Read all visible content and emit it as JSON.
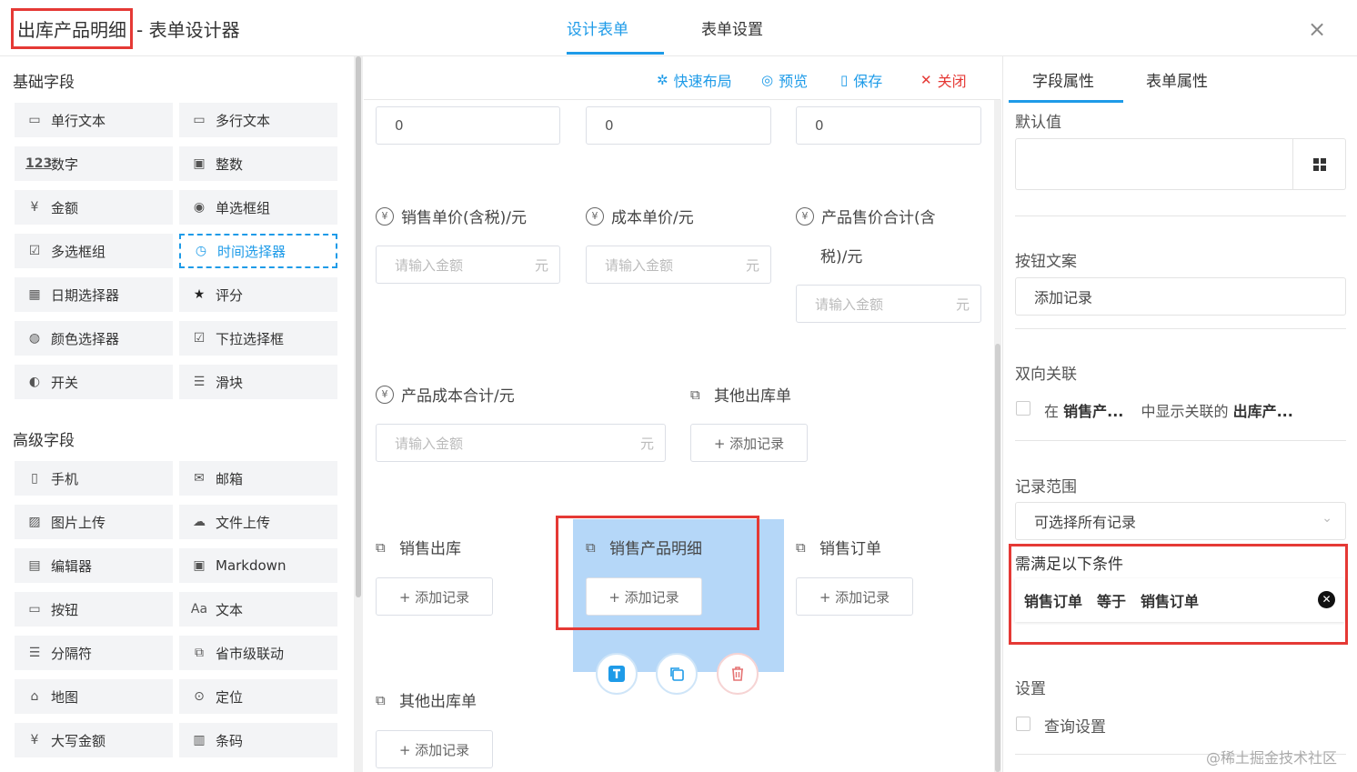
{
  "header": {
    "title": "出库产品明细",
    "subtitle": "- 表单设计器",
    "tabs": [
      "设计表单",
      "表单设置"
    ],
    "close": "×"
  },
  "left": {
    "basic_title": "基础字段",
    "basic_items": [
      {
        "icon": "▭",
        "label": "单行文本"
      },
      {
        "icon": "▭",
        "label": "多行文本"
      },
      {
        "icon": "123",
        "label": "数字"
      },
      {
        "icon": "▣",
        "label": "整数"
      },
      {
        "icon": "¥",
        "label": "金额"
      },
      {
        "icon": "◉",
        "label": "单选框组"
      },
      {
        "icon": "☑",
        "label": "多选框组"
      },
      {
        "icon": "◷",
        "label": "时间选择器"
      },
      {
        "icon": "▦",
        "label": "日期选择器"
      },
      {
        "icon": "★",
        "label": "评分"
      },
      {
        "icon": "◍",
        "label": "颜色选择器"
      },
      {
        "icon": "☑",
        "label": "下拉选择框"
      },
      {
        "icon": "◐",
        "label": "开关"
      },
      {
        "icon": "☰",
        "label": "滑块"
      }
    ],
    "advanced_title": "高级字段",
    "advanced_items": [
      {
        "icon": "▯",
        "label": "手机"
      },
      {
        "icon": "✉",
        "label": "邮箱"
      },
      {
        "icon": "▨",
        "label": "图片上传"
      },
      {
        "icon": "☁",
        "label": "文件上传"
      },
      {
        "icon": "▤",
        "label": "编辑器"
      },
      {
        "icon": "▣",
        "label": "Markdown"
      },
      {
        "icon": "▭",
        "label": "按钮"
      },
      {
        "icon": "Aa",
        "label": "文本"
      },
      {
        "icon": "☰",
        "label": "分隔符"
      },
      {
        "icon": "⧉",
        "label": "省市级联动"
      },
      {
        "icon": "⌂",
        "label": "地图"
      },
      {
        "icon": "⊙",
        "label": "定位"
      },
      {
        "icon": "¥",
        "label": "大写金额"
      },
      {
        "icon": "▥",
        "label": "条码"
      }
    ]
  },
  "toolbar": {
    "quick_layout": "快速布局",
    "preview": "预览",
    "save": "保存",
    "close": "关闭"
  },
  "canvas": {
    "top_values": [
      "0",
      "0",
      "0"
    ],
    "sale_price_label": "销售单价(含税)/元",
    "cost_price_label": "成本单价/元",
    "total_sale_label_1": "产品售价合计(含",
    "total_sale_label_2": "税)/元",
    "amount_placeholder": "请输入金额",
    "unit": "元",
    "cost_total_label": "产品成本合计/元",
    "other_out_label": "其他出库单",
    "add_record": "+ 添加记录",
    "sales_out_label": "销售出库",
    "sales_detail_label": "销售产品明细",
    "sales_order_label": "销售订单",
    "other_out_label_2": "其他出库单"
  },
  "right": {
    "tabs": [
      "字段属性",
      "表单属性"
    ],
    "default_value_label": "默认值",
    "button_text_label": "按钮文案",
    "button_text_value": "添加记录",
    "bidirectional_label": "双向关联",
    "bidirectional_text_1": "在",
    "bidirectional_bold_1": "销售产...",
    "bidirectional_text_2": "中显示关联的",
    "bidirectional_bold_2": "出库产...",
    "record_range_label": "记录范围",
    "record_range_value": "可选择所有记录",
    "conditions_label": "需满足以下条件",
    "condition_field": "销售订单",
    "condition_op": "等于",
    "condition_value": "销售订单",
    "settings_label": "设置",
    "query_settings": "查询设置"
  },
  "watermark": "@稀土掘金技术社区",
  "colors": {
    "accent": "#1e9be8",
    "danger": "#e53935",
    "highlight": "#b5d7f8"
  }
}
